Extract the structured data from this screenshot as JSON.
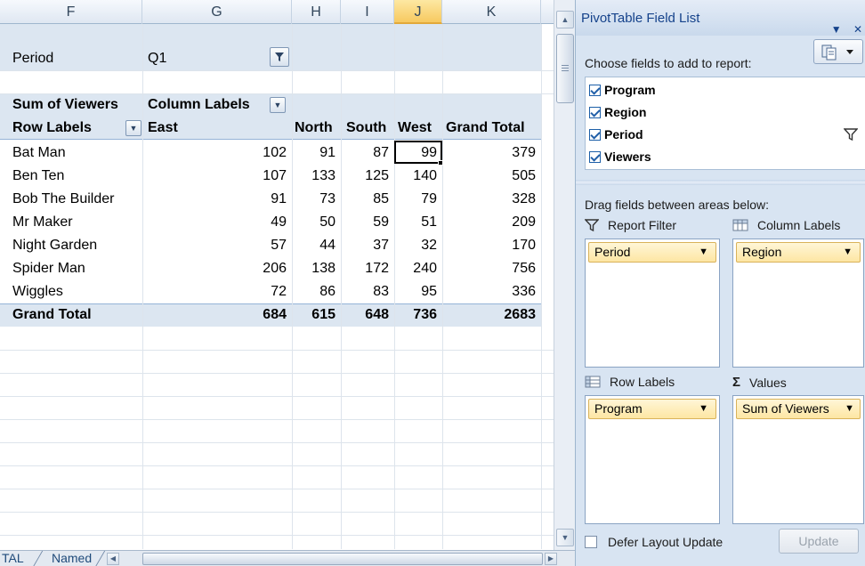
{
  "sheet": {
    "columns": [
      "F",
      "G",
      "H",
      "I",
      "J",
      "K"
    ],
    "selected_column": "J",
    "filter": {
      "label": "Period",
      "value": "Q1"
    },
    "values_label": "Sum of Viewers",
    "column_labels": "Column Labels",
    "row_labels": "Row Labels",
    "regions": [
      "East",
      "North",
      "South",
      "West",
      "Grand Total"
    ],
    "rows": [
      {
        "name": "Bat Man",
        "values": [
          "102",
          "91",
          "87",
          "99",
          "379"
        ]
      },
      {
        "name": "Ben Ten",
        "values": [
          "107",
          "133",
          "125",
          "140",
          "505"
        ]
      },
      {
        "name": "Bob The Builder",
        "values": [
          "91",
          "73",
          "85",
          "79",
          "328"
        ]
      },
      {
        "name": "Mr Maker",
        "values": [
          "49",
          "50",
          "59",
          "51",
          "209"
        ]
      },
      {
        "name": "Night Garden",
        "values": [
          "57",
          "44",
          "37",
          "32",
          "170"
        ]
      },
      {
        "name": "Spider Man",
        "values": [
          "206",
          "138",
          "172",
          "240",
          "756"
        ]
      },
      {
        "name": "Wiggles",
        "values": [
          "72",
          "86",
          "83",
          "95",
          "336"
        ]
      }
    ],
    "grand_total": {
      "label": "Grand Total",
      "values": [
        "684",
        "615",
        "648",
        "736",
        "2683"
      ]
    }
  },
  "tabs": {
    "tab1": "TAL",
    "tab2": "Named"
  },
  "pivot_panel": {
    "title": "PivotTable Field List",
    "choose_fields": "Choose fields to add to report:",
    "fields": [
      "Program",
      "Region",
      "Period",
      "Viewers"
    ],
    "drag_label": "Drag fields between areas below:",
    "areas": {
      "report_filter": {
        "label": "Report Filter",
        "item": "Period"
      },
      "column_labels": {
        "label": "Column Labels",
        "item": "Region"
      },
      "row_labels": {
        "label": "Row Labels",
        "item": "Program"
      },
      "values": {
        "label": "Values",
        "item": "Sum of Viewers"
      }
    },
    "defer_label": "Defer Layout Update",
    "update_label": "Update"
  },
  "colors": {
    "header_band": "#dce6f1",
    "panel_bg": "#d8e4f2",
    "field_item": "#fde6a3",
    "title_text": "#15428b"
  }
}
